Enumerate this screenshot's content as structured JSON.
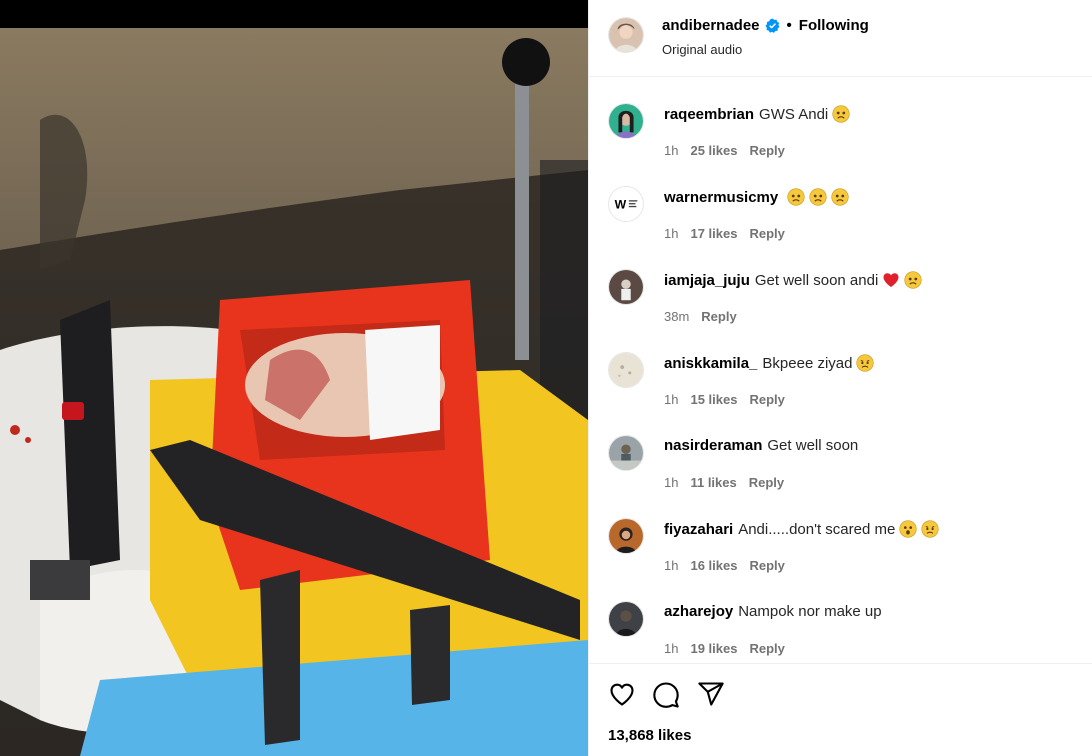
{
  "post": {
    "username": "andibernadee",
    "follow_status": "Following",
    "separator": "•",
    "audio": "Original audio",
    "likes_total": "13,868 likes"
  },
  "comments": [
    {
      "username": "raqeembrian",
      "text": "GWS Andi",
      "emojis": [
        "frowning-face"
      ],
      "time": "1h",
      "likes": "25 likes",
      "reply": "Reply"
    },
    {
      "username": "warnermusicmy",
      "text": "",
      "emojis": [
        "frowning-face",
        "frowning-face",
        "frowning-face"
      ],
      "time": "1h",
      "likes": "17 likes",
      "reply": "Reply"
    },
    {
      "username": "iamjaja_juju",
      "text": "Get well soon andi",
      "emojis": [
        "red-heart",
        "frowning-face"
      ],
      "time": "38m",
      "likes": "",
      "reply": "Reply"
    },
    {
      "username": "aniskkamila_",
      "text": "Bkpeee ziyad",
      "emojis": [
        "sad-face"
      ],
      "time": "1h",
      "likes": "15 likes",
      "reply": "Reply"
    },
    {
      "username": "nasirderaman",
      "text": "Get well soon",
      "emojis": [],
      "time": "1h",
      "likes": "11 likes",
      "reply": "Reply"
    },
    {
      "username": "fiyazahari",
      "text": "Andi.....don't scared me",
      "emojis": [
        "hushed-face",
        "sad-face"
      ],
      "time": "1h",
      "likes": "16 likes",
      "reply": "Reply"
    },
    {
      "username": "azharejoy",
      "text": "Nampok nor make up",
      "emojis": [],
      "time": "1h",
      "likes": "19 likes",
      "reply": "Reply"
    }
  ],
  "icons": {
    "like": "heart-icon",
    "comment": "comment-icon",
    "share": "share-icon",
    "verified": "verified-badge-icon"
  },
  "colors": {
    "verified": "#0095f6",
    "secondary_text": "#737373",
    "divider": "#efefef"
  }
}
